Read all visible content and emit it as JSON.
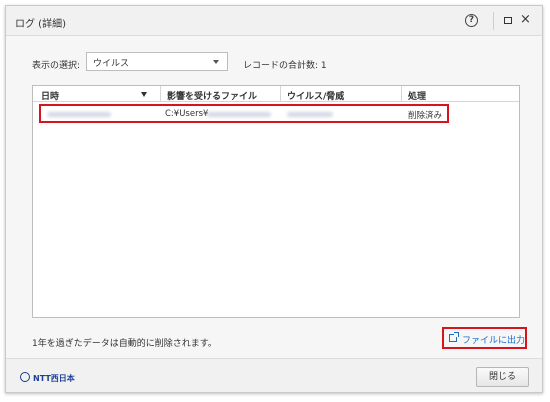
{
  "window": {
    "title": "ログ (詳細)",
    "help_icon": "question-circle-icon",
    "maximize_icon": "maximize-icon",
    "close_icon": "close-icon",
    "close_glyph": "×"
  },
  "filter": {
    "label": "表示の選択:",
    "selected": "ウイルス",
    "record_count_label": "レコードの合計数: 1"
  },
  "table": {
    "columns": [
      "日時",
      "影響を受けるファイル",
      "ウイルス/脅威",
      "処理"
    ],
    "rows": [
      {
        "file": "C:¥Users¥",
        "action": "削除済み"
      }
    ]
  },
  "note": "1年を過ぎたデータは自動的に削除されます。",
  "export_button": "ファイルに出力",
  "footer": {
    "logo_text": "NTT西日本",
    "close_button": "閉じる"
  },
  "colors": {
    "highlight": "#d9131e",
    "link": "#1a6fc9",
    "brand": "#1b3f95"
  }
}
